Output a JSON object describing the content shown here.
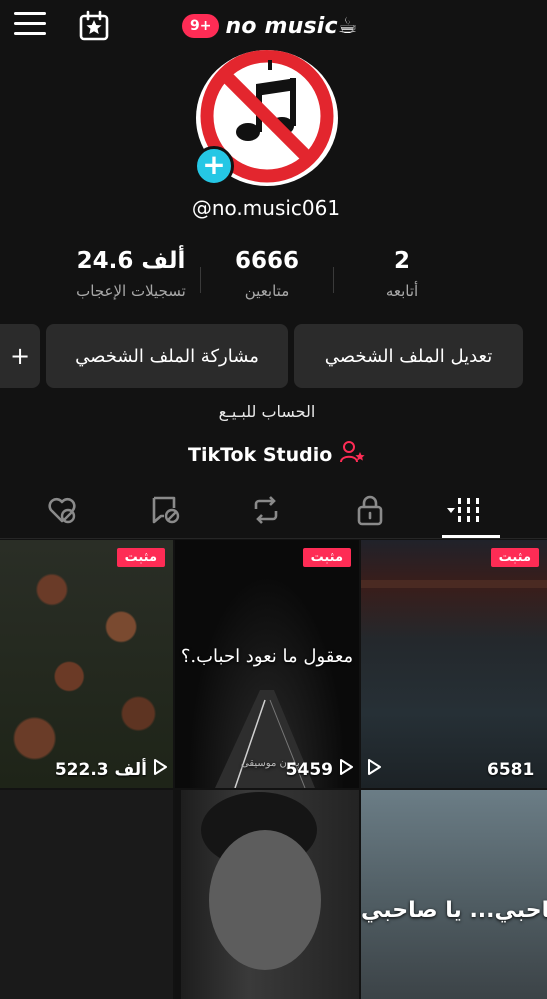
{
  "header": {
    "menu_icon": "hamburger-menu-icon",
    "calendar_icon": "calendar-star-icon",
    "notification_badge": "9+",
    "title": "no music☕"
  },
  "profile": {
    "username": "@no.music061",
    "stats": [
      {
        "value": "2",
        "label": "أتابعه"
      },
      {
        "value": "6666",
        "label": "متابعين"
      },
      {
        "value": "24.6 ألف",
        "label": "تسجيلات الإعجاب"
      }
    ],
    "buttons": {
      "edit": "تعديل الملف الشخصي",
      "share": "مشاركة الملف الشخصي",
      "add": "+"
    },
    "bio": "الحساب للبـيـع",
    "studio": "TikTok Studio"
  },
  "tabs": [
    "grid-icon",
    "lock-icon",
    "repost-icon",
    "tagged-icon",
    "liked-icon"
  ],
  "videos": [
    {
      "pinned": "مثبت",
      "views": "6581"
    },
    {
      "pinned": "مثبت",
      "views": "5459",
      "caption": "معقول ما نعود احباب.؟",
      "watermark": "بدون موسيقى"
    },
    {
      "pinned": "مثبت",
      "views": "522.3 ألف"
    },
    {
      "caption": "صاحبي... يا صاحبي"
    }
  ],
  "colors": {
    "accent": "#fe2c55",
    "add_button": "#25c7e5",
    "background": "#121212"
  }
}
